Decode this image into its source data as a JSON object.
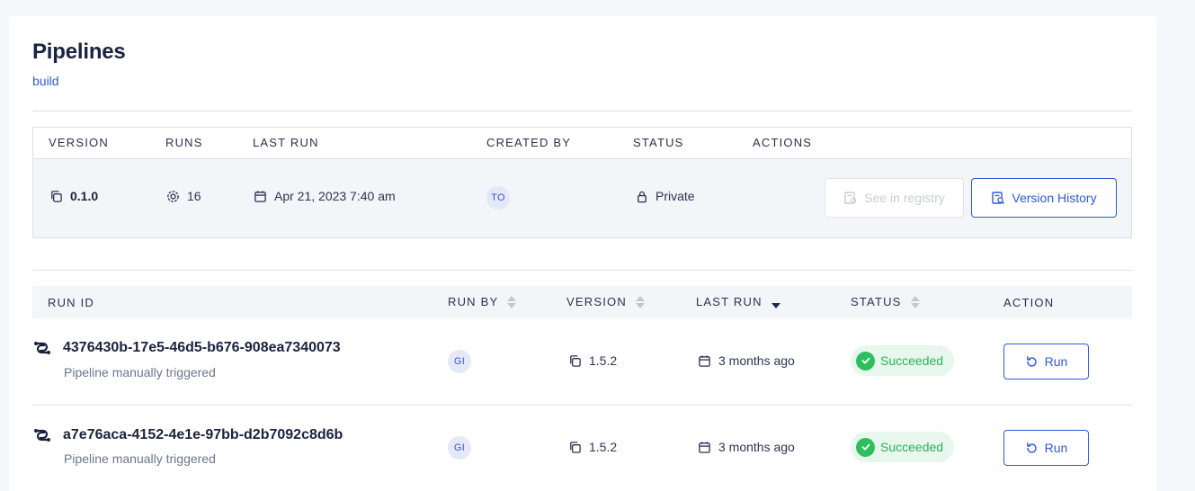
{
  "page": {
    "title": "Pipelines",
    "subtitle": "build"
  },
  "versions_table": {
    "headers": {
      "version": "VERSION",
      "runs": "RUNS",
      "last_run": "LAST RUN",
      "created_by": "CREATED BY",
      "status": "STATUS",
      "actions": "ACTIONS"
    },
    "row": {
      "version": "0.1.0",
      "runs": "16",
      "last_run": "Apr 21, 2023 7:40 am",
      "created_by": "TO",
      "status": "Private",
      "see_registry_label": "See in registry",
      "version_history_label": "Version History"
    }
  },
  "runs_table": {
    "headers": {
      "run_id": "RUN ID",
      "run_by": "RUN BY",
      "version": "VERSION",
      "last_run": "LAST RUN",
      "status": "STATUS",
      "action": "ACTION"
    },
    "rows": [
      {
        "id": "4376430b-17e5-46d5-b676-908ea7340073",
        "trigger": "Pipeline manually triggered",
        "run_by": "GI",
        "version": "1.5.2",
        "last_run": "3 months ago",
        "status": "Succeeded",
        "action_label": "Run"
      },
      {
        "id": "a7e76aca-4152-4e1e-97bb-d2b7092c8d6b",
        "trigger": "Pipeline manually triggered",
        "run_by": "GI",
        "version": "1.5.2",
        "last_run": "3 months ago",
        "status": "Succeeded",
        "action_label": "Run"
      }
    ]
  },
  "colors": {
    "accent": "#2f5bd4",
    "success": "#2ebd5f",
    "title": "#1b2240"
  },
  "icons": {
    "version": "copy-icon",
    "runs": "runs-icon",
    "calendar": "calendar-icon",
    "status_private": "lock-icon",
    "registry": "registry-icon",
    "history": "history-search-icon",
    "run_id": "pipeline-run-icon",
    "success": "check-icon",
    "rerun": "refresh-icon"
  }
}
